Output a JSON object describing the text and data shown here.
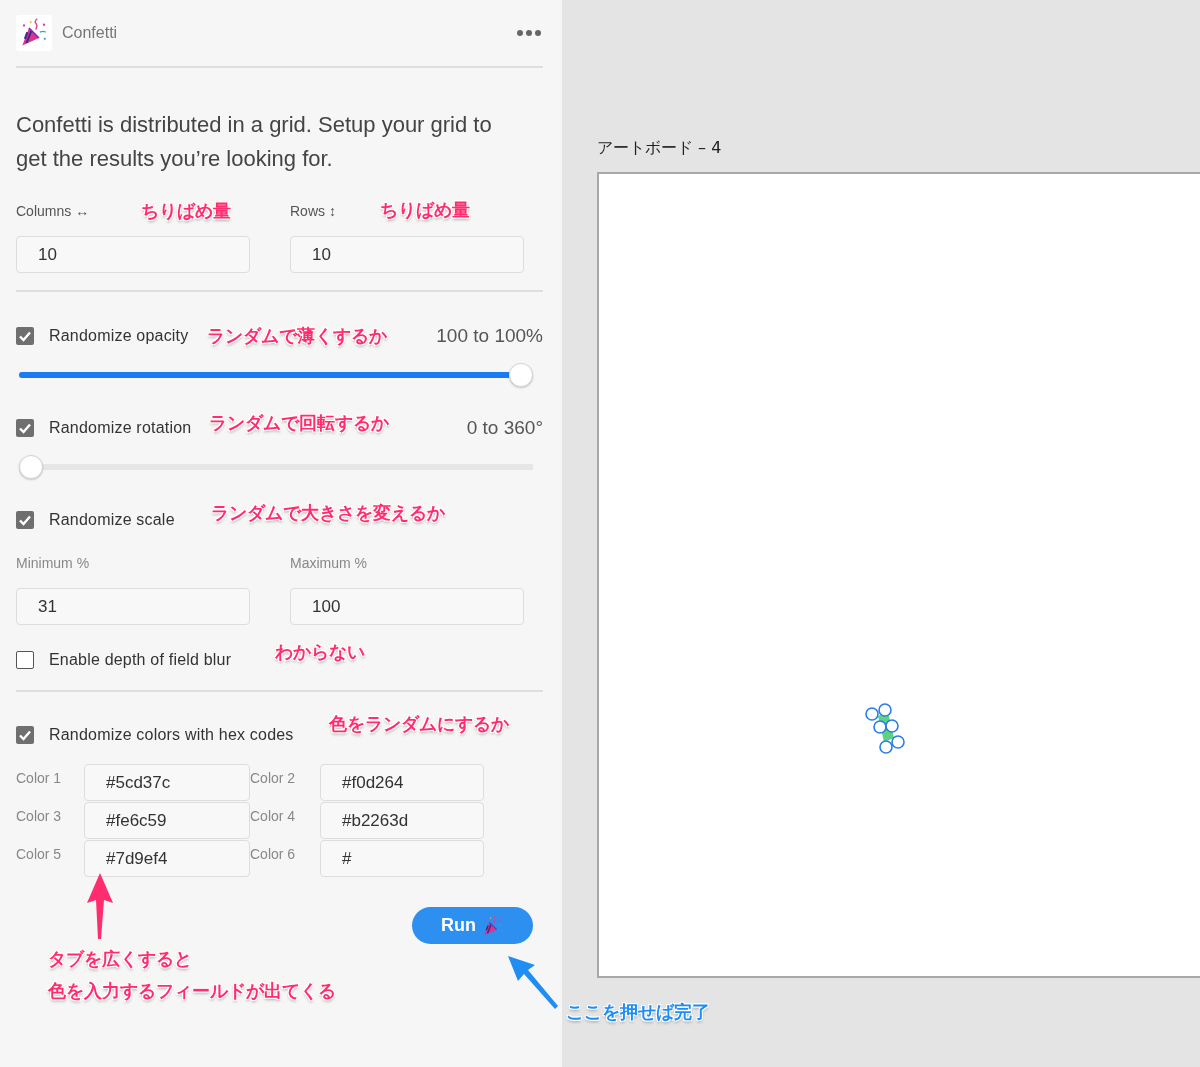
{
  "plugin": {
    "name": "Confetti"
  },
  "intro": "Confetti is distributed in a grid. Setup your grid to get the results you’re looking for.",
  "grid_fields": [
    {
      "label": "Columns ↔",
      "value": "10"
    },
    {
      "label": "Rows ↕",
      "value": "10"
    }
  ],
  "options": [
    {
      "kind": "slider",
      "label": "Randomize opacity",
      "checked": true,
      "reading": "100 to 100%",
      "level": 1
    },
    {
      "kind": "slider",
      "label": "Randomize rotation",
      "checked": true,
      "reading": "0 to 360°",
      "level": 0
    },
    {
      "kind": "plain",
      "label": "Randomize scale",
      "checked": true
    }
  ],
  "scale_fields": [
    {
      "label": "Minimum %",
      "value": "31"
    },
    {
      "label": "Maximum %",
      "value": "100"
    }
  ],
  "depth_blur": {
    "label": "Enable depth of field blur",
    "checked": false
  },
  "colors_option": {
    "label": "Randomize colors with hex codes",
    "checked": true
  },
  "color_fields": [
    {
      "label": "Color 1",
      "value": "#5cd37c"
    },
    {
      "label": "Color 2",
      "value": "#f0d264"
    },
    {
      "label": "Color 3",
      "value": "#fe6c59"
    },
    {
      "label": "Color 4",
      "value": "#b2263d"
    },
    {
      "label": "Color 5",
      "value": "#7d9ef4"
    },
    {
      "label": "Color 6",
      "value": "#"
    }
  ],
  "run_button": {
    "label": "Run"
  },
  "artboard": {
    "title": "アートボード – 4"
  },
  "annotations": [
    {
      "text": "ちりばめ量",
      "color": "#ff2d6e"
    },
    {
      "text": "ちりばめ量",
      "color": "#ff2d6e"
    },
    {
      "text": "ランダムで薄くするか",
      "color": "#ff2d6e"
    },
    {
      "text": "ランダムで回転するか",
      "color": "#ff2d6e"
    },
    {
      "text": "ランダムで大きさを変えるか",
      "color": "#ff2d6e"
    },
    {
      "text": "わからない",
      "color": "#ff2d6e"
    },
    {
      "text": "色をランダムにするか",
      "color": "#ff2d6e"
    },
    {
      "text": "タブを広くすると",
      "color": "#ff2d6e"
    },
    {
      "text": "色を入力するフィールドが出てくる",
      "color": "#ff2d6e"
    },
    {
      "text": "ここを押せば完了",
      "color": "#1e8ef5"
    }
  ]
}
